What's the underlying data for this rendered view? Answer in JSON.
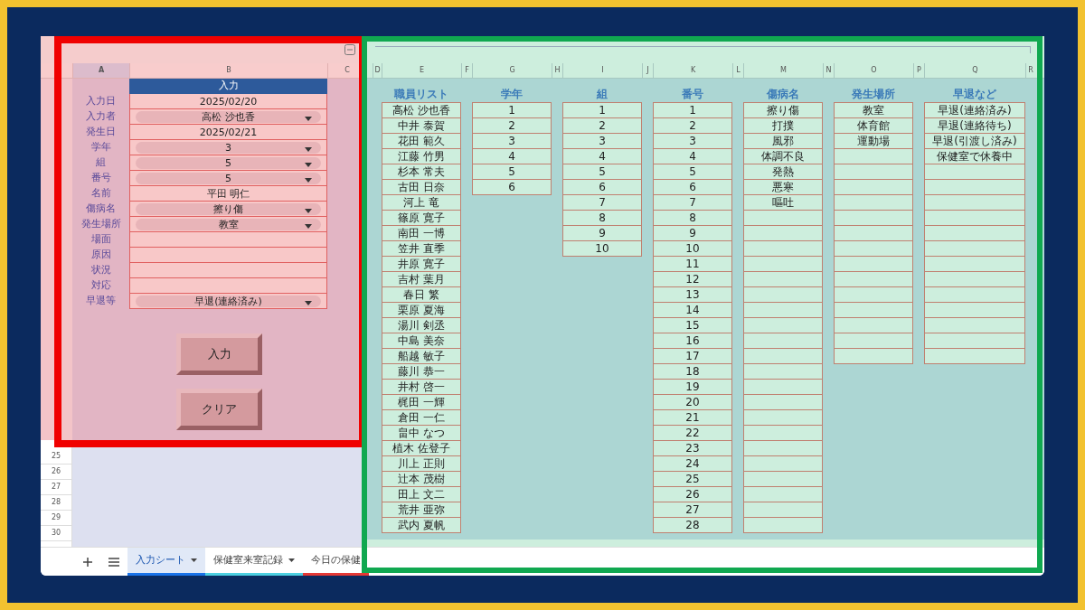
{
  "columns_left": [
    {
      "label": "A",
      "selected": true
    },
    {
      "label": "B",
      "selected": false
    },
    {
      "label": "C",
      "selected": false
    }
  ],
  "columns_right": [
    "D",
    "E",
    "F",
    "G",
    "H",
    "I",
    "J",
    "K",
    "L",
    "M",
    "N",
    "O",
    "P",
    "Q",
    "R"
  ],
  "form": {
    "title": "入力",
    "fields": [
      {
        "label": "入力日",
        "value": "2025/02/20",
        "kind": "text"
      },
      {
        "label": "入力者",
        "value": "高松 沙也香",
        "kind": "dropdown"
      },
      {
        "label": "発生日",
        "value": "2025/02/21",
        "kind": "text"
      },
      {
        "label": "学年",
        "value": "3",
        "kind": "dropdown"
      },
      {
        "label": "組",
        "value": "5",
        "kind": "dropdown"
      },
      {
        "label": "番号",
        "value": "5",
        "kind": "dropdown"
      },
      {
        "label": "名前",
        "value": "平田 明仁",
        "kind": "text"
      },
      {
        "label": "傷病名",
        "value": "擦り傷",
        "kind": "dropdown"
      },
      {
        "label": "発生場所",
        "value": "教室",
        "kind": "dropdown"
      },
      {
        "label": "場面",
        "kind": "text"
      },
      {
        "label": "原因",
        "kind": "text"
      },
      {
        "label": "状況",
        "kind": "text"
      },
      {
        "label": "対応",
        "kind": "text"
      },
      {
        "label": "早退等",
        "value": "早退(連絡済み)",
        "kind": "dropdown"
      }
    ],
    "buttons": [
      "入力",
      "クリア"
    ]
  },
  "row_numbers": [
    "25",
    "26",
    "27",
    "28",
    "29",
    "30"
  ],
  "lists": [
    {
      "title": "職員リスト",
      "items": [
        "高松 沙也香",
        "中井 泰賀",
        "花田 範久",
        "江藤 竹男",
        "杉本 常夫",
        "古田 日奈",
        "河上 竜",
        "篠原 寛子",
        "南田 一博",
        "笠井 直季",
        "井原 寛子",
        "吉村 葉月",
        "春日 繁",
        "栗原 夏海",
        "湯川 剣丞",
        "中島 美奈",
        "船越 敏子",
        "藤川 恭一",
        "井村 啓一",
        "梶田 一輝",
        "倉田 一仁",
        "畠中 なつ",
        "植木 佐登子",
        "川上 正則",
        "辻本 茂樹",
        "田上 文二",
        "荒井 亜弥",
        "武内 夏帆"
      ]
    },
    {
      "title": "学年",
      "items": [
        "1",
        "2",
        "3",
        "4",
        "5",
        "6"
      ]
    },
    {
      "title": "組",
      "items": [
        "1",
        "2",
        "3",
        "4",
        "5",
        "6",
        "7",
        "8",
        "9",
        "10"
      ]
    },
    {
      "title": "番号",
      "items": [
        "1",
        "2",
        "3",
        "4",
        "5",
        "6",
        "7",
        "8",
        "9",
        "10",
        "11",
        "12",
        "13",
        "14",
        "15",
        "16",
        "17",
        "18",
        "19",
        "20",
        "21",
        "22",
        "23",
        "24",
        "25",
        "26",
        "27",
        "28"
      ]
    },
    {
      "title": "傷病名",
      "items": [
        "擦り傷",
        "打撲",
        "風邪",
        "体調不良",
        "発熱",
        "悪寒",
        "嘔吐"
      ]
    },
    {
      "title": "発生場所",
      "items": [
        "教室",
        "体育館",
        "運動場"
      ]
    },
    {
      "title": "早退など",
      "items": [
        "早退(連絡済み)",
        "早退(連絡待ち)",
        "早退(引渡し済み)",
        "保健室で休養中"
      ]
    }
  ],
  "tabs": [
    {
      "label": "入力シート",
      "selected": true,
      "has_menu": true,
      "color": "#1a73e8"
    },
    {
      "label": "保健室来室記録",
      "selected": false,
      "has_menu": true,
      "color": "#4dd0e1"
    },
    {
      "label": "今日の保健",
      "selected": false,
      "has_menu": false,
      "color": "#e53935"
    }
  ]
}
